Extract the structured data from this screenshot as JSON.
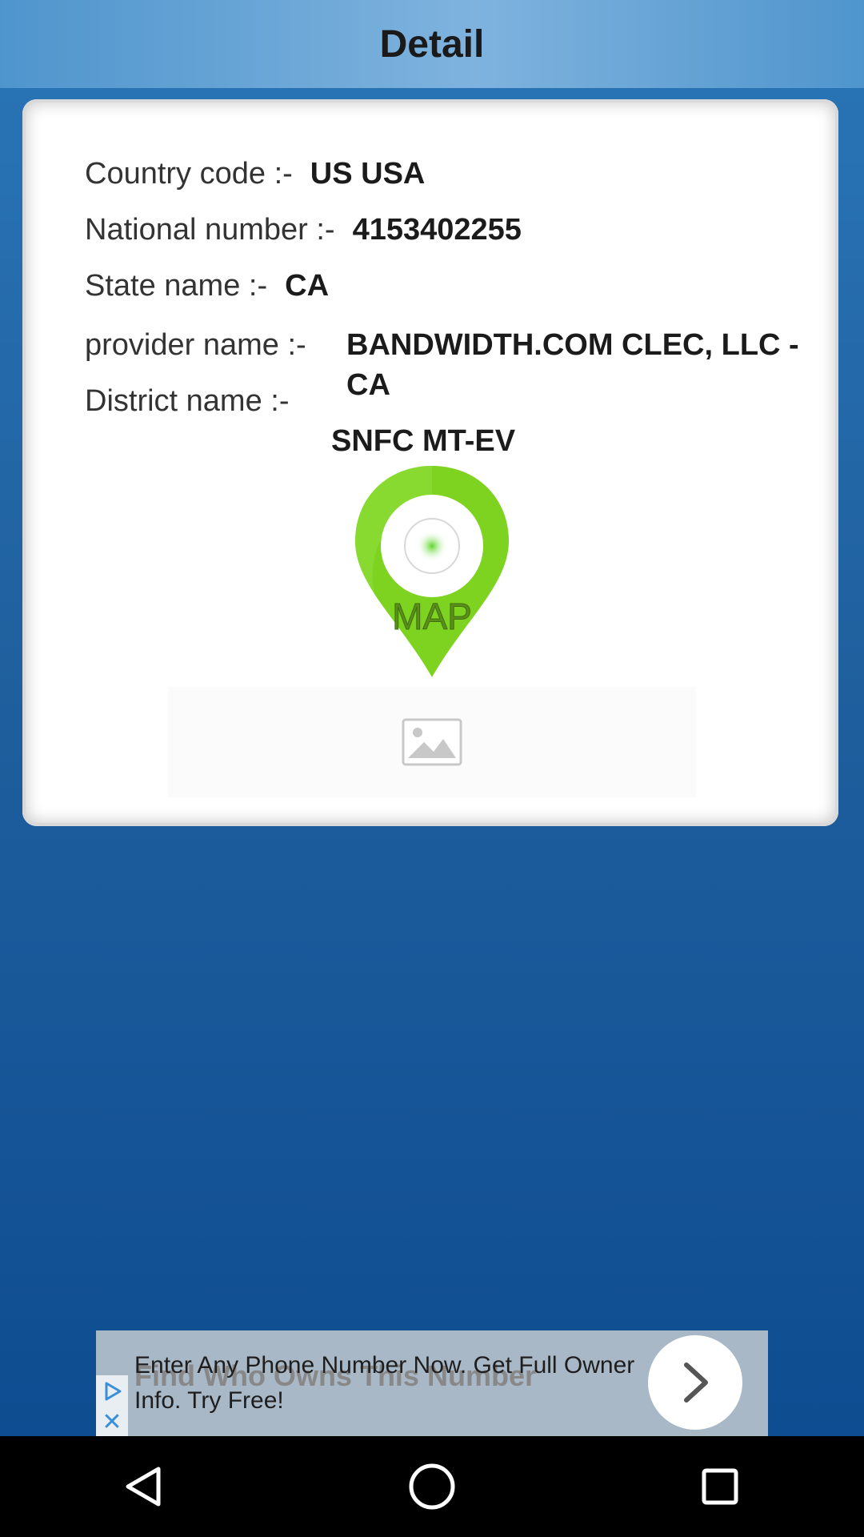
{
  "header": {
    "title": "Detail"
  },
  "details": {
    "country_code_label": "Country code :-",
    "country_code_value": "US USA",
    "national_number_label": "National number :-",
    "national_number_value": "4153402255",
    "state_name_label": "State name :-",
    "state_name_value": "CA",
    "provider_name_label": "provider name :-",
    "provider_name_value": "BANDWIDTH.COM CLEC, LLC - CA",
    "district_name_label": "District name :-",
    "district_name_value": "SNFC MT-EV"
  },
  "map_button": {
    "label": "MAP",
    "icon": "map-pin-icon",
    "color": "#7ed321"
  },
  "image_placeholder": {
    "icon": "image-icon"
  },
  "ad": {
    "text": "Enter Any Phone Number Now. Get Full Owner Info. Try Free!",
    "background_text": "Find Who Owns This Number",
    "play_icon": "ad-play-icon",
    "close_icon": "close-icon",
    "arrow_icon": "chevron-right-icon"
  },
  "navigation": {
    "back_icon": "back-triangle-icon",
    "home_icon": "home-circle-icon",
    "recents_icon": "recents-square-icon"
  }
}
